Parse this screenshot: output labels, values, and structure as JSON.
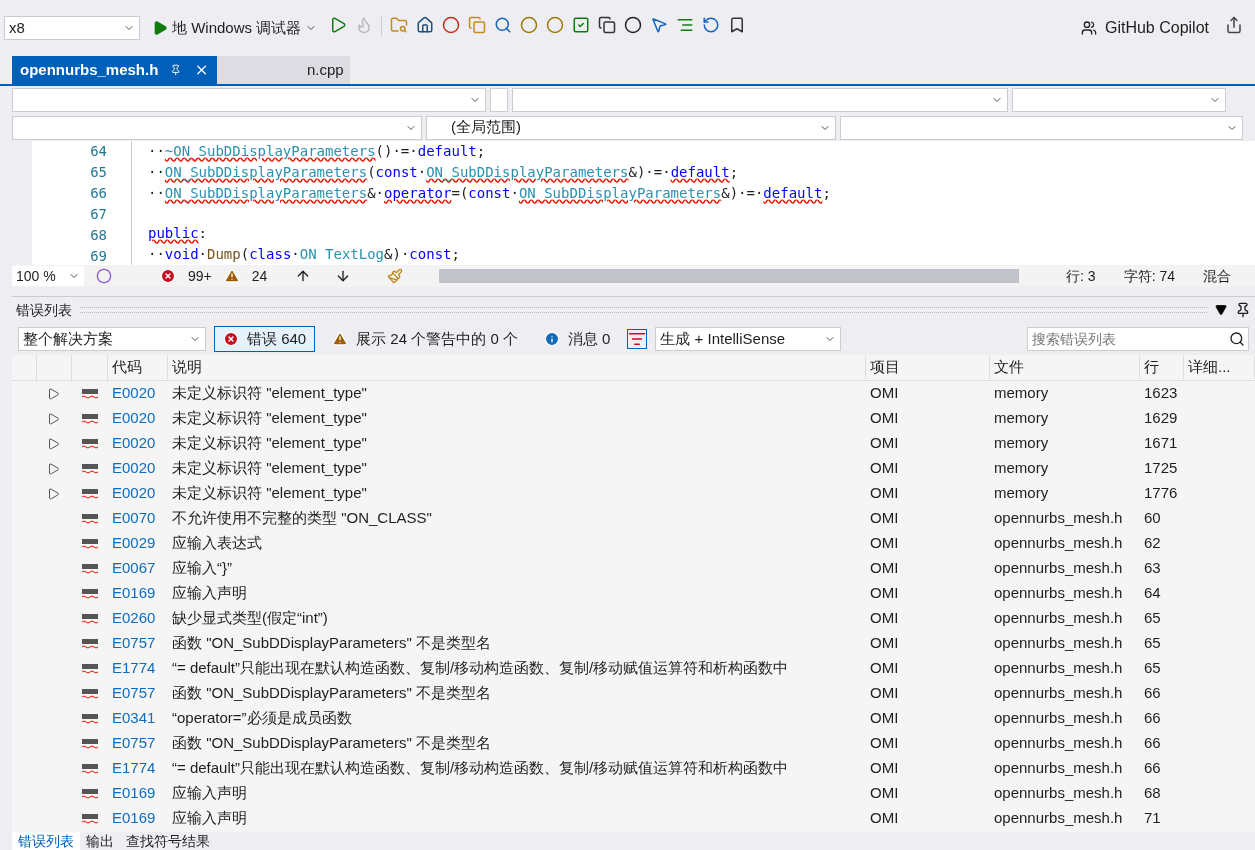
{
  "toolbar": {
    "platform": "x8",
    "debugger": "地 Windows 调试器",
    "copilot": "GitHub Copilot"
  },
  "tabs": [
    {
      "label": "opennurbs_mesh.h",
      "selected": true
    },
    {
      "label": "n.cpp",
      "selected": false
    }
  ],
  "nav": {
    "scope": "(全局范围)"
  },
  "code": [
    {
      "number": "64",
      "tokens": [
        {
          "text": "··",
          "kind": "plain"
        },
        {
          "text": "~ON_SubDDisplayParameters",
          "kind": "type",
          "squiggle": true
        },
        {
          "text": "()·=·",
          "kind": "plain"
        },
        {
          "text": "default",
          "kind": "keyword"
        },
        {
          "text": ";",
          "kind": "plain"
        }
      ]
    },
    {
      "number": "65",
      "tokens": [
        {
          "text": "··",
          "kind": "plain"
        },
        {
          "text": "ON_SubDDisplayParameters",
          "kind": "type",
          "squiggle": true
        },
        {
          "text": "(",
          "kind": "plain"
        },
        {
          "text": "const",
          "kind": "keyword"
        },
        {
          "text": "·",
          "kind": "plain"
        },
        {
          "text": "ON_SubDDisplayParameters",
          "kind": "type",
          "squiggle": true
        },
        {
          "text": "&)·=·",
          "kind": "plain"
        },
        {
          "text": "default",
          "kind": "keyword",
          "squiggle": true
        },
        {
          "text": ";",
          "kind": "plain"
        }
      ]
    },
    {
      "number": "66",
      "tokens": [
        {
          "text": "··",
          "kind": "plain"
        },
        {
          "text": "ON_SubDDisplayParameters",
          "kind": "type",
          "squiggle": true
        },
        {
          "text": "&·",
          "kind": "plain"
        },
        {
          "text": "operator",
          "kind": "keyword",
          "squiggle": true
        },
        {
          "text": "=(",
          "kind": "plain"
        },
        {
          "text": "const",
          "kind": "keyword"
        },
        {
          "text": "·",
          "kind": "plain"
        },
        {
          "text": "ON_SubDDisplayParameters",
          "kind": "type",
          "squiggle": true
        },
        {
          "text": "&)·=·",
          "kind": "plain"
        },
        {
          "text": "default",
          "kind": "keyword",
          "squiggle": true
        },
        {
          "text": ";",
          "kind": "plain"
        }
      ]
    },
    {
      "number": "67"
    },
    {
      "number": "68",
      "tokens": [
        {
          "text": "public",
          "kind": "keyword",
          "squiggle": true
        },
        {
          "text": ":",
          "kind": "plain"
        }
      ]
    },
    {
      "number": "69",
      "tokens": [
        {
          "text": "··",
          "kind": "plain"
        },
        {
          "text": "void",
          "kind": "keyword"
        },
        {
          "text": "·",
          "kind": "plain"
        },
        {
          "text": "Dump",
          "kind": "function"
        },
        {
          "text": "(",
          "kind": "plain"
        },
        {
          "text": "class",
          "kind": "keyword"
        },
        {
          "text": "·",
          "kind": "plain"
        },
        {
          "text": "ON TextLog",
          "kind": "type"
        },
        {
          "text": "&)·",
          "kind": "plain"
        },
        {
          "text": "const",
          "kind": "keyword"
        },
        {
          "text": ";",
          "kind": "plain"
        }
      ]
    }
  ],
  "editor_status": {
    "zoom": "100 %",
    "errors": "99+",
    "warnings": "24",
    "line": "行: 3",
    "char": "字符: 74",
    "mode": "混合"
  },
  "error_list": {
    "title": "错误列表",
    "scope": "整个解决方案",
    "filters": [
      {
        "kind": "error",
        "label": "错误 640",
        "selected": true
      },
      {
        "kind": "warning",
        "label": "展示 24 个警告中的 0 个",
        "selected": false
      },
      {
        "kind": "info",
        "label": "消息 0",
        "selected": false
      }
    ],
    "source": "生成 + IntelliSense",
    "search_placeholder": "搜索错误列表",
    "columns": [
      "代码",
      "说明",
      "项目",
      "文件",
      "行",
      "详细..."
    ],
    "rows": [
      {
        "expandable": true,
        "code": "E0020",
        "description": "未定义标识符 \"element_type\"",
        "project": "OMI",
        "file": "memory",
        "line": "1623"
      },
      {
        "expandable": true,
        "code": "E0020",
        "description": "未定义标识符 \"element_type\"",
        "project": "OMI",
        "file": "memory",
        "line": "1629"
      },
      {
        "expandable": true,
        "code": "E0020",
        "description": "未定义标识符 \"element_type\"",
        "project": "OMI",
        "file": "memory",
        "line": "1671"
      },
      {
        "expandable": true,
        "code": "E0020",
        "description": "未定义标识符 \"element_type\"",
        "project": "OMI",
        "file": "memory",
        "line": "1725"
      },
      {
        "expandable": true,
        "code": "E0020",
        "description": "未定义标识符 \"element_type\"",
        "project": "OMI",
        "file": "memory",
        "line": "1776"
      },
      {
        "expandable": false,
        "code": "E0070",
        "description": "不允许使用不完整的类型 \"ON_CLASS\"",
        "project": "OMI",
        "file": "opennurbs_mesh.h",
        "line": "60"
      },
      {
        "expandable": false,
        "code": "E0029",
        "description": "应输入表达式",
        "project": "OMI",
        "file": "opennurbs_mesh.h",
        "line": "62"
      },
      {
        "expandable": false,
        "code": "E0067",
        "description": "应输入“}”",
        "project": "OMI",
        "file": "opennurbs_mesh.h",
        "line": "63"
      },
      {
        "expandable": false,
        "code": "E0169",
        "description": "应输入声明",
        "project": "OMI",
        "file": "opennurbs_mesh.h",
        "line": "64"
      },
      {
        "expandable": false,
        "code": "E0260",
        "description": "缺少显式类型(假定“int”)",
        "project": "OMI",
        "file": "opennurbs_mesh.h",
        "line": "65"
      },
      {
        "expandable": false,
        "code": "E0757",
        "description": "函数 \"ON_SubDDisplayParameters\" 不是类型名",
        "project": "OMI",
        "file": "opennurbs_mesh.h",
        "line": "65"
      },
      {
        "expandable": false,
        "code": "E1774",
        "description": "“= default”只能出现在默认构造函数、复制/移动构造函数、复制/移动赋值运算符和析构函数中",
        "project": "OMI",
        "file": "opennurbs_mesh.h",
        "line": "65"
      },
      {
        "expandable": false,
        "code": "E0757",
        "description": "函数 \"ON_SubDDisplayParameters\" 不是类型名",
        "project": "OMI",
        "file": "opennurbs_mesh.h",
        "line": "66"
      },
      {
        "expandable": false,
        "code": "E0341",
        "description": "“operator=”必须是成员函数",
        "project": "OMI",
        "file": "opennurbs_mesh.h",
        "line": "66"
      },
      {
        "expandable": false,
        "code": "E0757",
        "description": "函数 \"ON_SubDDisplayParameters\" 不是类型名",
        "project": "OMI",
        "file": "opennurbs_mesh.h",
        "line": "66"
      },
      {
        "expandable": false,
        "code": "E1774",
        "description": "“= default”只能出现在默认构造函数、复制/移动构造函数、复制/移动赋值运算符和析构函数中",
        "project": "OMI",
        "file": "opennurbs_mesh.h",
        "line": "66"
      },
      {
        "expandable": false,
        "code": "E0169",
        "description": "应输入声明",
        "project": "OMI",
        "file": "opennurbs_mesh.h",
        "line": "68"
      },
      {
        "expandable": false,
        "code": "E0169",
        "description": "应输入声明",
        "project": "OMI",
        "file": "opennurbs_mesh.h",
        "line": "71"
      }
    ]
  },
  "bottom_tabs": [
    {
      "label": "错误列表",
      "selected": true
    },
    {
      "label": "输出",
      "selected": false
    },
    {
      "label": "查找符号结果",
      "selected": false
    }
  ]
}
